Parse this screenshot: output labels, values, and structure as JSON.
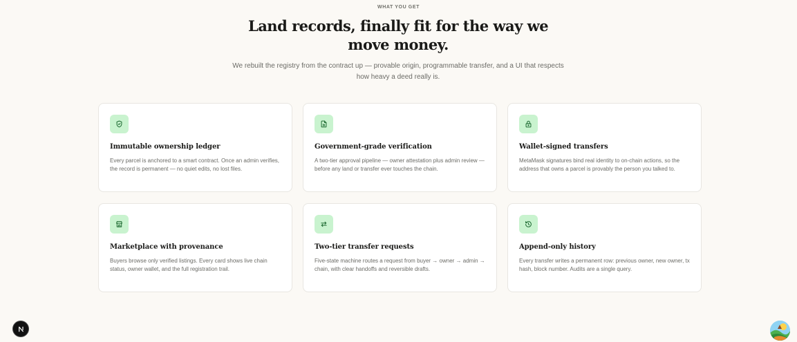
{
  "hero": {
    "eyebrow": "WHAT YOU GET",
    "title": "Land records, finally fit for the way we move money.",
    "subtitle": "We rebuilt the registry from the contract up — provable origin, programmable transfer, and a UI that respects how heavy a deed really is."
  },
  "features": [
    {
      "icon": "shield-check-icon",
      "title": "Immutable ownership ledger",
      "description": "Every parcel is anchored to a smart contract. Once an admin verifies, the record is permanent — no quiet edits, no lost files."
    },
    {
      "icon": "file-signature-icon",
      "title": "Government-grade verification",
      "description": "A two-tier approval pipeline — owner attestation plus admin review — before any land or transfer ever touches the chain."
    },
    {
      "icon": "lock-icon",
      "title": "Wallet-signed transfers",
      "description": "MetaMask signatures bind real identity to on-chain actions, so the address that owns a parcel is provably the person you talked to."
    },
    {
      "icon": "store-icon",
      "title": "Marketplace with provenance",
      "description": "Buyers browse only verified listings. Every card shows live chain status, owner wallet, and the full registration trail."
    },
    {
      "icon": "arrows-left-right-icon",
      "title": "Two-tier transfer requests",
      "description": "Five-state machine routes a request from buyer → owner → admin → chain, with clear handoffs and reversible drafts."
    },
    {
      "icon": "history-icon",
      "title": "Append-only history",
      "description": "Every transfer writes a permanent row: previous owner, new owner, tx hash, block number. Audits are a single query."
    }
  ],
  "badge": {
    "icon": "nextjs-logo-icon"
  },
  "colors": {
    "background": "#fbf9f5",
    "icon_bg": "#c9f3cf",
    "icon_stroke": "#1f6b33"
  }
}
